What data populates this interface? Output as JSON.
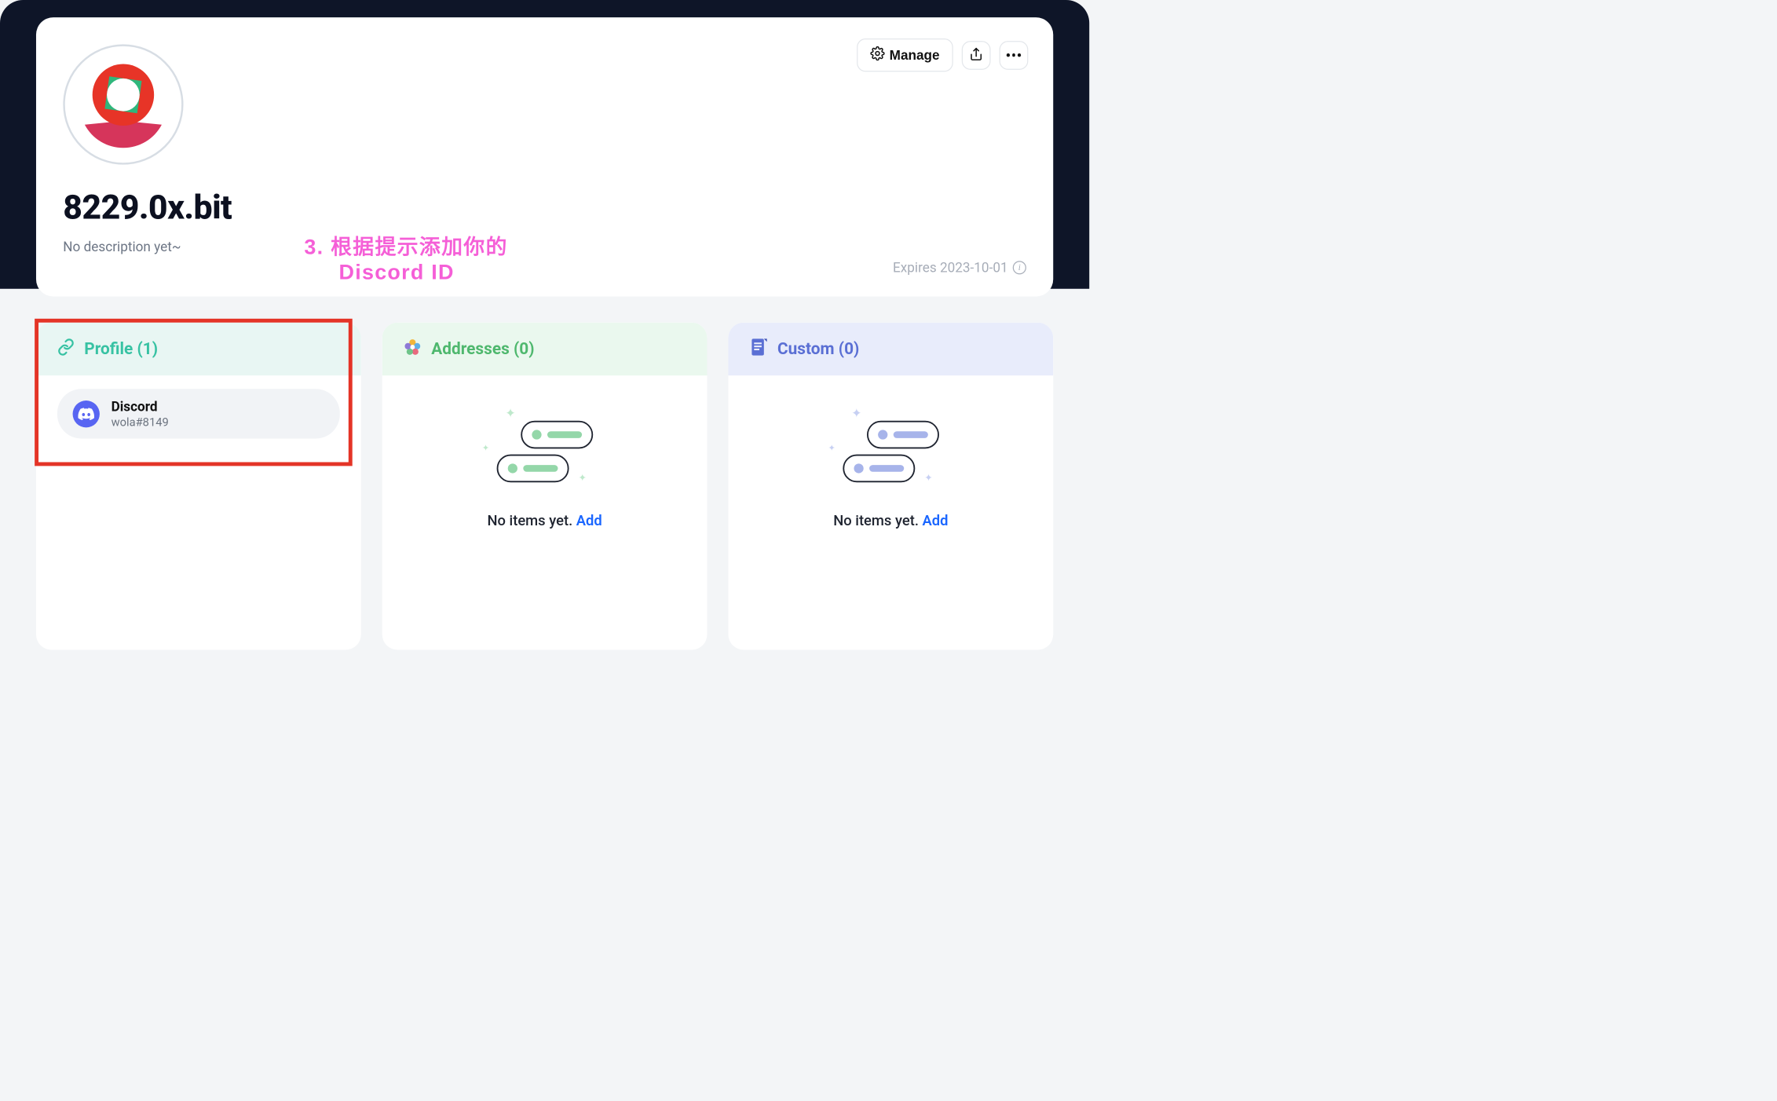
{
  "profile": {
    "name": "8229.0x.bit",
    "description": "No description yet~",
    "expires_label": "Expires 2023-10-01"
  },
  "actions": {
    "manage_label": "Manage"
  },
  "annotation": {
    "line1": "3. 根据提示添加你的",
    "line2": "Discord ID"
  },
  "sections": {
    "profile": {
      "title": "Profile (1)",
      "items": [
        {
          "label": "Discord",
          "value": "wola#8149"
        }
      ]
    },
    "addresses": {
      "title": "Addresses (0)",
      "empty_text": "No items yet.",
      "add_label": "Add"
    },
    "custom": {
      "title": "Custom (0)",
      "empty_text": "No items yet.",
      "add_label": "Add"
    }
  }
}
